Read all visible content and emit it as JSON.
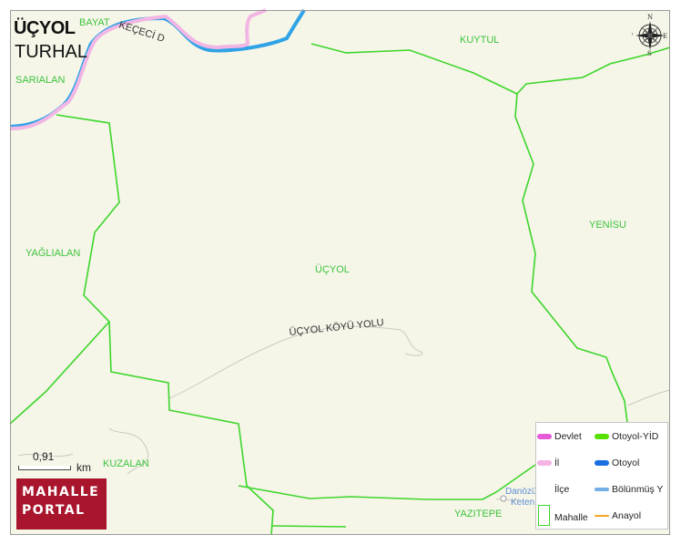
{
  "map": {
    "title": "ÜÇYOL",
    "subtitle": "TURHAL",
    "background_color": "#f5f5e8",
    "boundary_color": "#3dd62a",
    "neighborhoods": [
      "BAYAT",
      "KUYTUL",
      "SARIALAN",
      "YENİSU",
      "YAĞLIALAN",
      "ÜÇYOL",
      "KUZALAN",
      "YAZITEPE"
    ],
    "roads": {
      "kececi": "KEÇECİ D",
      "ucyol": "ÜÇYOL KÖYÜ YOLU"
    },
    "pois": [
      "Danözü",
      "Keten"
    ]
  },
  "scale": {
    "value": "0,91",
    "unit": "km"
  },
  "brand": {
    "line1": "MAHALLE",
    "line2": "PORTAL"
  },
  "compass": {
    "n": "N",
    "s": "S",
    "e": "E",
    "w": "W"
  },
  "legend": {
    "items": [
      {
        "label": "Devlet",
        "color": "#e55ad6"
      },
      {
        "label": "Otoyol-YİD",
        "color": "#58e000"
      },
      {
        "label": "İl",
        "color": "#f4b4e6"
      },
      {
        "label": "Otoyol",
        "color": "#1a6fe0"
      },
      {
        "label": "İlçe",
        "color": "#ffffff"
      },
      {
        "label": "Bölünmüş Y",
        "color": "#74aee6"
      },
      {
        "label": "Mahalle",
        "color": "#3dd62a"
      },
      {
        "label": "Anayol",
        "color": "#f5a623"
      }
    ]
  }
}
